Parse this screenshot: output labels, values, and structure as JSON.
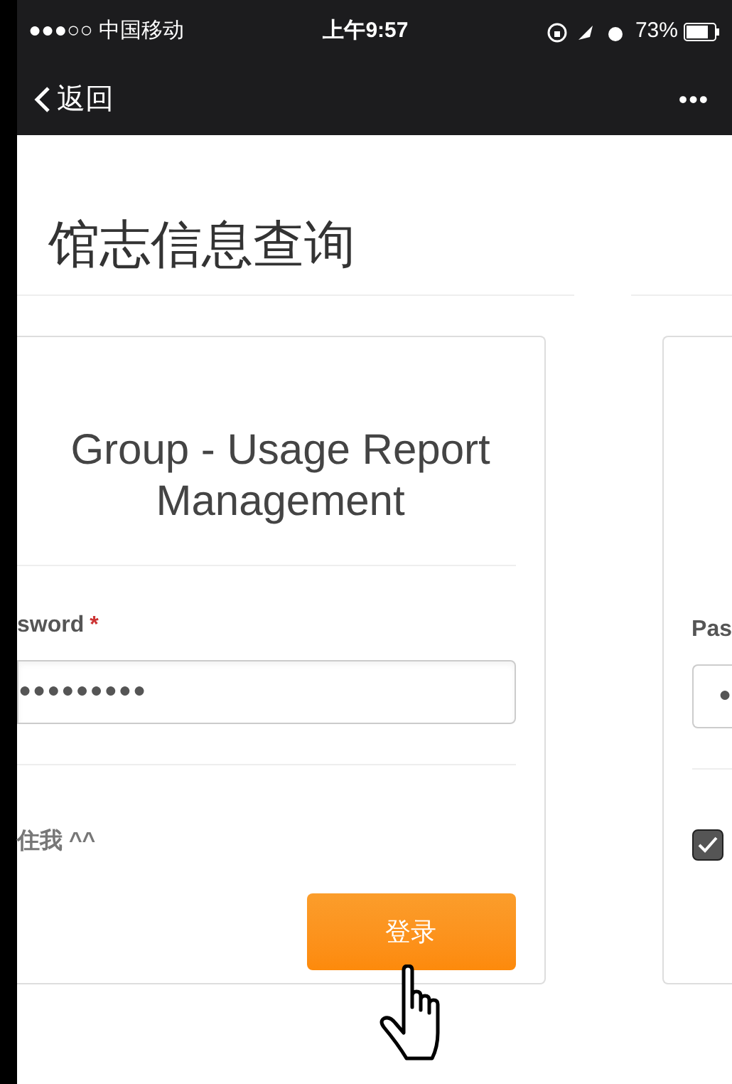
{
  "status_bar": {
    "carrier": "●●●○○ 中国移动",
    "time": "上午9:57",
    "battery": "73%"
  },
  "nav": {
    "back": "返回",
    "more": "•••"
  },
  "page_title": "馆志信息查询",
  "login_card": {
    "heading_line_1": "Group - Usage Report",
    "heading_line_2": "Management",
    "password_label": "sword",
    "required_mark": "*",
    "password_value": "●●●●●●●●●",
    "remember_label": "住我 ^^",
    "submit": "登录"
  },
  "second_card": {
    "password_label": "Pas",
    "password_value": "●",
    "remember": {
      "checked": true
    }
  }
}
